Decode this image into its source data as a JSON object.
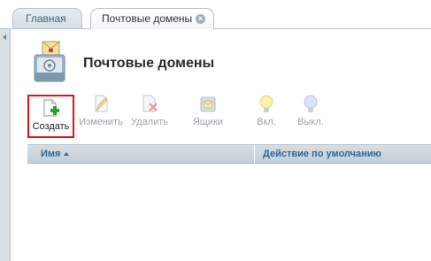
{
  "tabs": [
    {
      "label": "Главная",
      "active": false
    },
    {
      "label": "Почтовые домены",
      "active": true
    }
  ],
  "page": {
    "title": "Почтовые домены"
  },
  "toolbar": {
    "create": {
      "label": "Создать",
      "icon": "new-document-icon",
      "enabled": true
    },
    "edit": {
      "label": "Изменить",
      "icon": "edit-icon",
      "enabled": false
    },
    "delete": {
      "label": "Удалить",
      "icon": "delete-icon",
      "enabled": false
    },
    "mailboxes": {
      "label": "Ящики",
      "icon": "mailbox-icon",
      "enabled": false
    },
    "enable": {
      "label": "Вкл.",
      "icon": "lightbulb-on-icon",
      "enabled": false
    },
    "disable": {
      "label": "Выкл.",
      "icon": "lightbulb-off-icon",
      "enabled": false
    }
  },
  "table": {
    "columns": [
      {
        "label": "Имя",
        "sort": "ascending"
      },
      {
        "label": "Действие по умолчанию"
      }
    ],
    "rows": []
  },
  "colors": {
    "highlight": "#dc1414",
    "header_text": "#2f6894"
  }
}
